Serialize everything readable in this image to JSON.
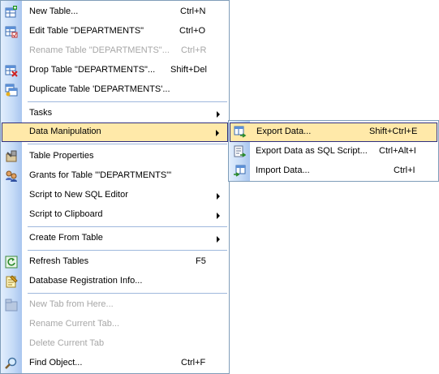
{
  "main_menu": {
    "items": [
      {
        "label": "New Table...",
        "shortcut": "Ctrl+N",
        "icon": "new-table-icon"
      },
      {
        "label": "Edit Table \"DEPARTMENTS\"",
        "shortcut": "Ctrl+O",
        "icon": "edit-table-icon"
      },
      {
        "label": "Rename Table \"DEPARTMENTS\"...",
        "shortcut": "Ctrl+R",
        "disabled": true
      },
      {
        "label": "Drop Table \"DEPARTMENTS\"...",
        "shortcut": "Shift+Del",
        "icon": "drop-table-icon"
      },
      {
        "label": "Duplicate Table 'DEPARTMENTS'...",
        "shortcut": "",
        "icon": "duplicate-table-icon"
      },
      {
        "label": "Tasks",
        "submenu": true
      },
      {
        "label": "Data Manipulation",
        "submenu": true,
        "highlighted": true
      },
      {
        "label": "Table Properties",
        "icon": "table-properties-icon"
      },
      {
        "label": "Grants for Table '\"DEPARTMENTS\"'",
        "icon": "grants-icon"
      },
      {
        "label": "Script to New SQL Editor",
        "submenu": true
      },
      {
        "label": "Script to Clipboard",
        "submenu": true
      },
      {
        "label": "Create From Table",
        "submenu": true
      },
      {
        "label": "Refresh Tables",
        "shortcut": "F5",
        "icon": "refresh-icon"
      },
      {
        "label": "Database Registration Info...",
        "icon": "registration-info-icon"
      },
      {
        "label": "New Tab from Here...",
        "disabled": true,
        "icon": "new-tab-icon"
      },
      {
        "label": "Rename Current Tab...",
        "disabled": true
      },
      {
        "label": "Delete Current Tab",
        "disabled": true
      },
      {
        "label": "Find Object...",
        "shortcut": "Ctrl+F",
        "icon": "find-icon"
      }
    ]
  },
  "sub_menu": {
    "items": [
      {
        "label": "Export Data...",
        "shortcut": "Shift+Ctrl+E",
        "highlighted": true,
        "icon": "export-data-icon"
      },
      {
        "label": "Export Data as SQL Script...",
        "shortcut": "Ctrl+Alt+I",
        "icon": "export-sql-icon"
      },
      {
        "label": "Import Data...",
        "shortcut": "Ctrl+I",
        "icon": "import-data-icon"
      }
    ]
  },
  "colors": {
    "highlight_bg": "#ffe9a9",
    "highlight_border": "#2f2f7f",
    "menu_border": "#7f9db9",
    "disabled_text": "#a7a7a7"
  }
}
